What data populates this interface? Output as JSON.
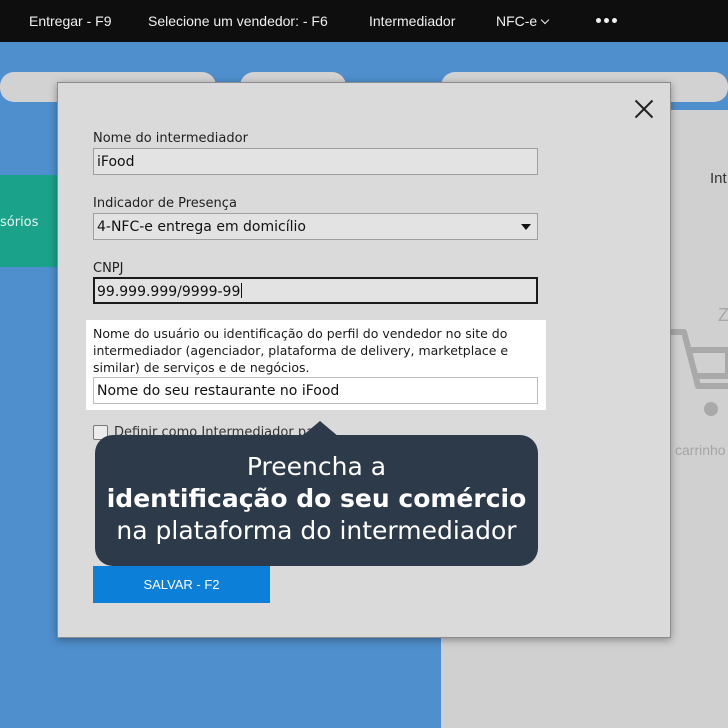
{
  "topbar": {
    "items": [
      "Entregar - F9",
      "Selecione um vendedor: - F6",
      "Intermediador",
      "NFC-e"
    ]
  },
  "background": {
    "green_item_label": "sórios",
    "right_panel_title": "Int",
    "empty_letter": "Z",
    "cart_text": "carrinho"
  },
  "modal": {
    "intermediary_name": {
      "label": "Nome do intermediador",
      "value": "iFood"
    },
    "presence": {
      "label": "Indicador de Presença",
      "value": "4-NFC-e entrega em domicílio"
    },
    "cnpj": {
      "label": "CNPJ",
      "value": "99.999.999/9999-99"
    },
    "user_id": {
      "label": "Nome do usuário ou identificação do perfil do vendedor no site do intermediador (agenciador, plataforma de delivery, marketplace e similar) de serviços e de negócios.",
      "value": "Nome do seu restaurante no iFood"
    },
    "default_checkbox_label": "Definir como Intermediador padrão",
    "save_label": "SALVAR - F2"
  },
  "tooltip": {
    "line1": "Preencha a",
    "line2": "identificação do seu comércio",
    "line3": "na plataforma do intermediador"
  },
  "colors": {
    "topbar": "#0e0e0e",
    "background": "#4f8fcd",
    "tooltip": "#2d3a4a",
    "save_button": "#0c7fd8",
    "accent_green": "#1aa38a"
  }
}
